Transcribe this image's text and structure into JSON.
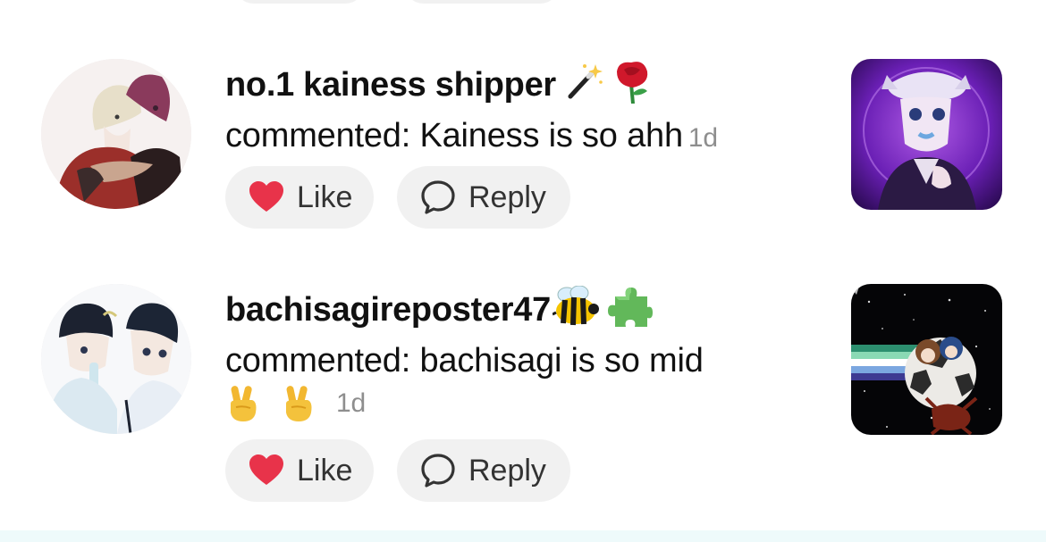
{
  "notifications": [
    {
      "username": "no.1 kainess shipper",
      "username_emojis": [
        "magic-wand-emoji",
        "rose-emoji"
      ],
      "comment_text": "commented: Kainess is so ahh",
      "time": "1d",
      "like_label": "Like",
      "reply_label": "Reply"
    },
    {
      "username": "bachisagireposter47",
      "username_emojis": [
        "bee-emoji",
        "puzzle-piece-emoji"
      ],
      "comment_text": "commented: bachisagi is so mid",
      "comment_emojis": [
        "victory-hand-emoji",
        "victory-hand-emoji"
      ],
      "time": "1d",
      "like_label": "Like",
      "reply_label": "Reply"
    }
  ],
  "colors": {
    "heart": "#e8334a",
    "pill_bg": "#f1f1f1",
    "time_gray": "#8e8e8e"
  }
}
